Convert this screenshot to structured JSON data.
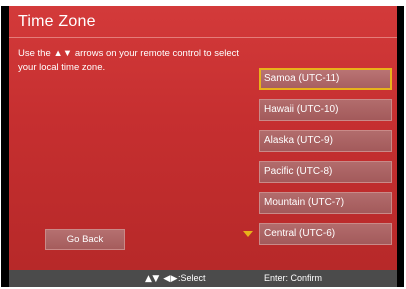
{
  "screen": {
    "title": "Time Zone",
    "instructions": "Use the ▲▼ arrows on your remote control to select your local time zone."
  },
  "time_zones": [
    {
      "label": "Samoa (UTC-11)",
      "selected": true
    },
    {
      "label": "Hawaii (UTC-10)",
      "selected": false
    },
    {
      "label": "Alaska (UTC-9)",
      "selected": false
    },
    {
      "label": "Pacific (UTC-8)",
      "selected": false
    },
    {
      "label": "Mountain (UTC-7)",
      "selected": false
    },
    {
      "label": "Central (UTC-6)",
      "selected": false
    }
  ],
  "buttons": {
    "go_back": "Go Back"
  },
  "footer": {
    "select_glyphs": "▲▼ ◀▶",
    "select_label": ":Select",
    "confirm_hint": "Enter: Confirm"
  },
  "icons": {
    "scroll_down": "triangle-down-icon"
  },
  "colors": {
    "panel": "#c62f30",
    "highlight": "#e8b21a",
    "footer": "#4b4b4b"
  }
}
